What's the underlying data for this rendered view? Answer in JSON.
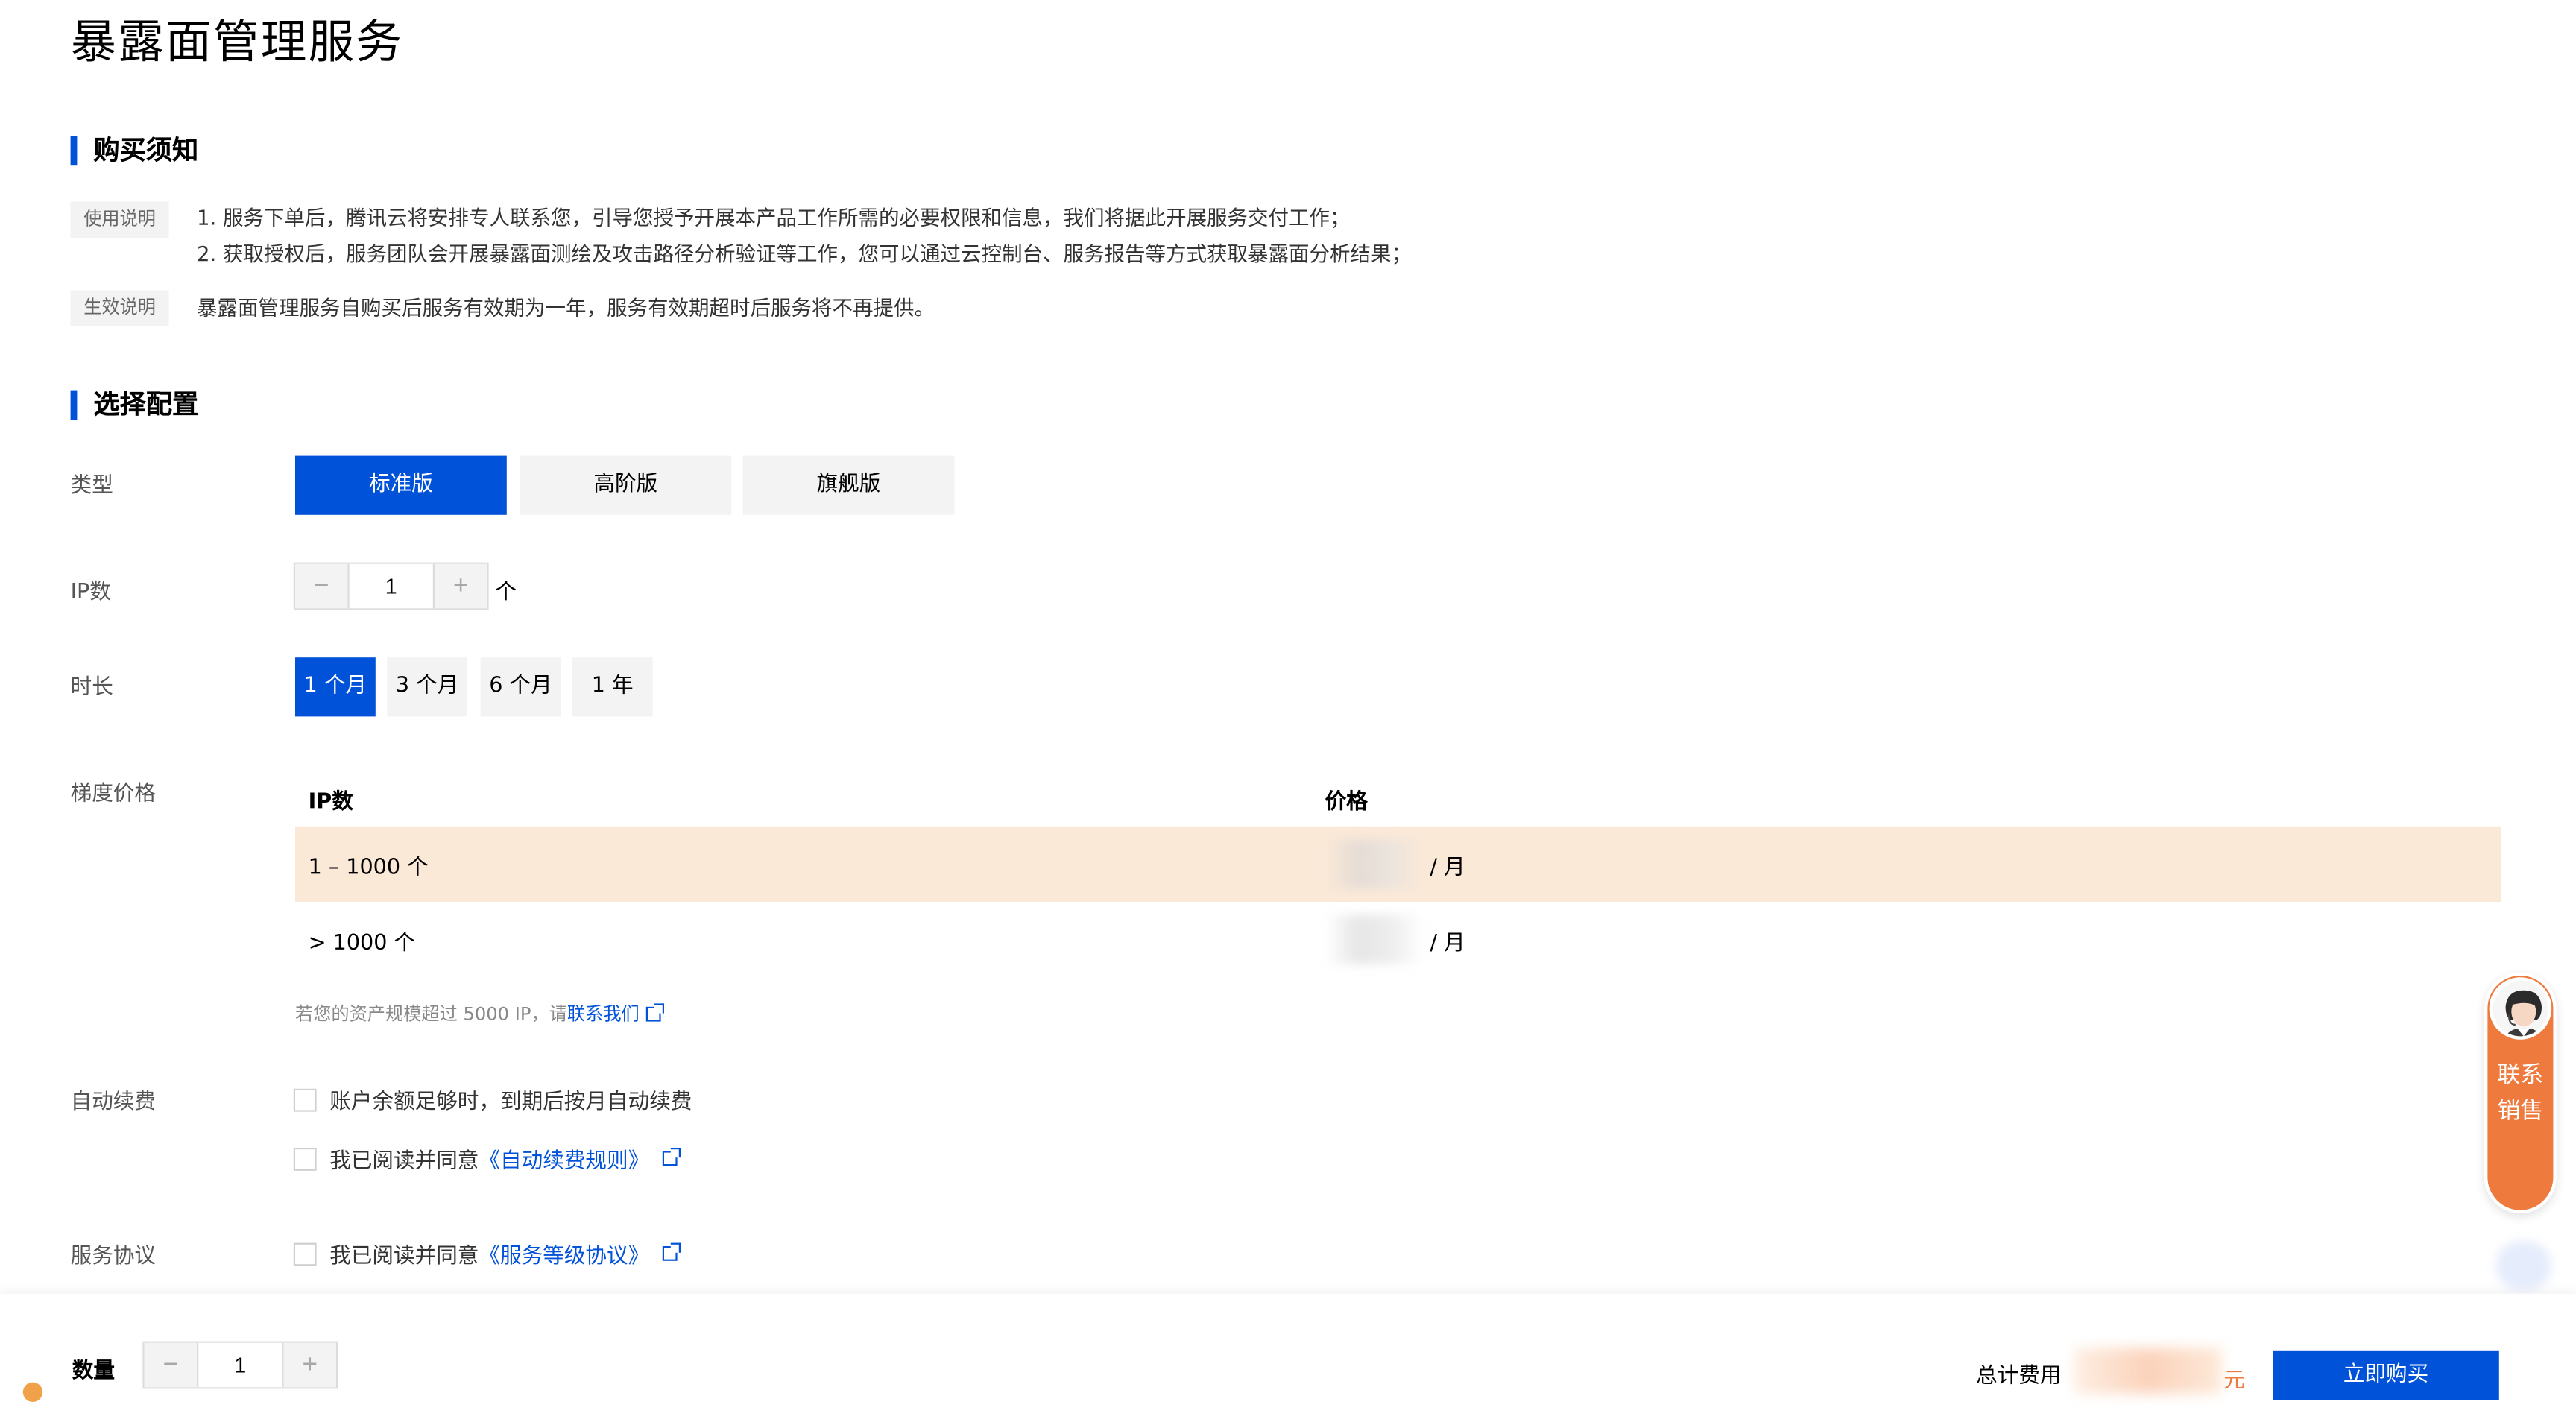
{
  "page": {
    "title": "暴露面管理服务"
  },
  "purchase_notice": {
    "heading": "购买须知",
    "usage_tag": "使用说明",
    "usage_lines": [
      "1. 服务下单后，腾讯云将安排专人联系您，引导您授予开展本产品工作所需的必要权限和信息，我们将据此开展服务交付工作；",
      "2. 获取授权后，服务团队会开展暴露面测绘及攻击路径分析验证等工作，您可以通过云控制台、服务报告等方式获取暴露面分析结果；"
    ],
    "effective_tag": "生效说明",
    "effective_text": "暴露面管理服务自购买后服务有效期为一年，服务有效期超时后服务将不再提供。"
  },
  "config": {
    "heading": "选择配置",
    "type": {
      "label": "类型",
      "options": [
        "标准版",
        "高阶版",
        "旗舰版"
      ],
      "selected": "标准版"
    },
    "ip_count": {
      "label": "IP数",
      "value": "1",
      "unit": "个",
      "minus": "−",
      "plus": "+"
    },
    "duration": {
      "label": "时长",
      "options": [
        "1 个月",
        "3 个月",
        "6 个月",
        "1 年"
      ],
      "selected": "1 个月"
    },
    "tier_price": {
      "label": "梯度价格",
      "headers": [
        "IP数",
        "价格"
      ],
      "rows": [
        {
          "range": "1 – 1000 个",
          "unit": "/ 月"
        },
        {
          "range": "> 1000 个",
          "unit": "/ 月"
        }
      ],
      "hint": "若您的资产规模超过 5000 IP，请",
      "hint_link": "联系我们"
    },
    "auto_renew": {
      "label": "自动续费",
      "option1": "账户余额足够时，到期后按月自动续费",
      "option2_prefix": "我已阅读并同意",
      "option2_link": "《自动续费规则》"
    },
    "service_agreement": {
      "label": "服务协议",
      "prefix": "我已阅读并同意",
      "link": "《服务等级协议》"
    }
  },
  "contact_widget": {
    "text": "联系销售",
    "icon": "customer-service-avatar"
  },
  "bottom_bar": {
    "quantity_label": "数量",
    "quantity_value": "1",
    "total_label": "总计费用",
    "currency": "元",
    "buy_label": "立即购买"
  },
  "colors": {
    "primary": "#0052d9",
    "highlight_row": "#fbe9d8",
    "contact_orange": "#ee7a3e"
  }
}
